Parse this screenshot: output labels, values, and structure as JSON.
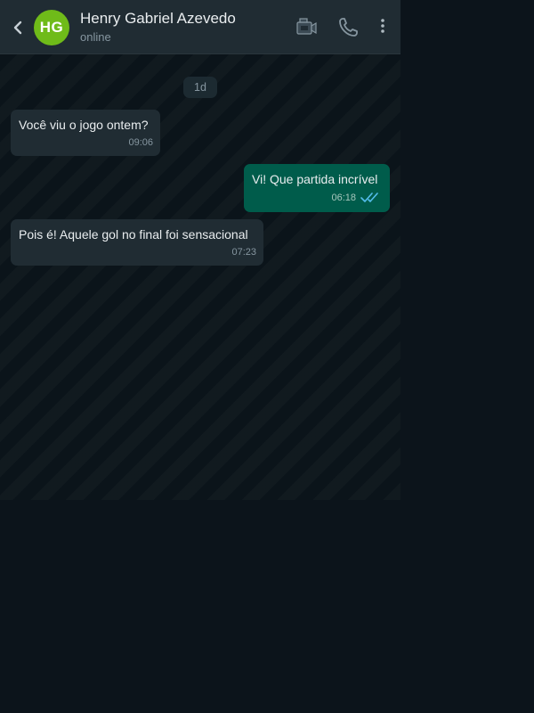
{
  "header": {
    "avatar_initials": "HG",
    "avatar_color": "#6fbb19",
    "contact_name": "Henry Gabriel Azevedo",
    "status": "online",
    "icons": [
      "back-chevron-icon",
      "video-camera-icon",
      "phone-icon",
      "more-vertical-icon"
    ]
  },
  "chat": {
    "date_divider": "1d",
    "messages": [
      {
        "direction": "incoming",
        "text": "Você viu o jogo ontem?",
        "time": "09:06"
      },
      {
        "direction": "outgoing",
        "text": "Vi! Que partida incrível",
        "time": "06:18",
        "status": "read"
      },
      {
        "direction": "incoming",
        "text": "Pois é! Aquele gol no final foi sensacional",
        "time": "07:23"
      }
    ]
  },
  "colors": {
    "header_bg": "#202c33",
    "chat_bg": "#0b141a",
    "incoming_bubble": "#202c33",
    "outgoing_bubble": "#005c4b",
    "read_ticks": "#53bdeb"
  }
}
